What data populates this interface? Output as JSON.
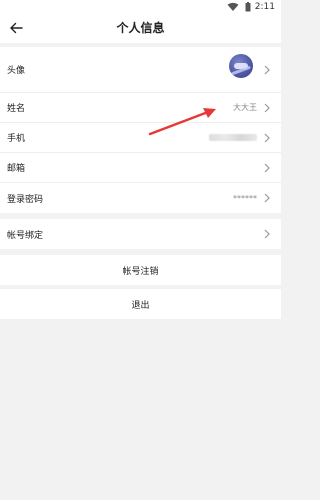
{
  "status_bar": {
    "time": "2:11",
    "wifi_icon": "wifi-icon",
    "battery_icon": "battery-icon"
  },
  "header": {
    "title": "个人信息",
    "back_icon": "back-arrow-icon"
  },
  "profile": {
    "avatar_label": "头像",
    "name_label": "姓名",
    "name_value": "大大王",
    "phone_label": "手机",
    "email_label": "邮箱",
    "password_label": "登录密码",
    "password_value": "******"
  },
  "binding": {
    "label": "帐号绑定"
  },
  "actions": {
    "deregister": "帐号注销",
    "logout": "退出"
  },
  "colors": {
    "background": "#f2f2f2",
    "card": "#ffffff",
    "annotation_arrow": "#e53935"
  }
}
